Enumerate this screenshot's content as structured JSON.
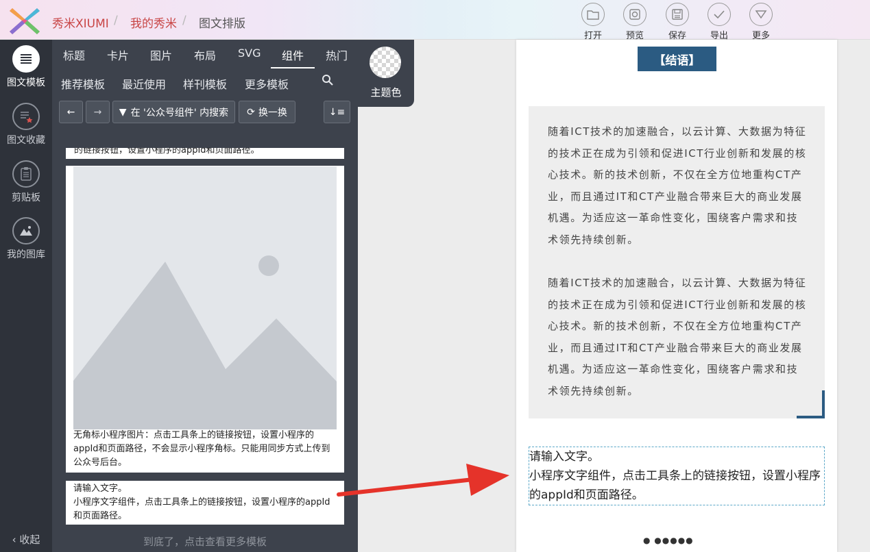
{
  "header": {
    "logo_icon": "xiumi-logo-icon",
    "breadcrumb": [
      "秀米XIUMI",
      "我的秀米",
      "图文排版"
    ],
    "tools": [
      {
        "label": "打开",
        "icon": "folder-icon"
      },
      {
        "label": "预览",
        "icon": "preview-icon"
      },
      {
        "label": "保存",
        "icon": "save-icon"
      },
      {
        "label": "导出",
        "icon": "check-icon"
      },
      {
        "label": "更多",
        "icon": "more-icon"
      }
    ]
  },
  "sidebar": {
    "items": [
      {
        "label": "图文模板",
        "icon": "template-icon"
      },
      {
        "label": "图文收藏",
        "icon": "favorites-icon"
      },
      {
        "label": "剪贴板",
        "icon": "clipboard-icon"
      },
      {
        "label": "我的图库",
        "icon": "gallery-icon"
      }
    ],
    "collapse_label": "收起"
  },
  "panel": {
    "tabs": [
      "标题",
      "卡片",
      "图片",
      "布局",
      "SVG",
      "组件",
      "热门"
    ],
    "active_tab": "组件",
    "subtabs": [
      "推荐模板",
      "最近使用",
      "样刊模板",
      "更多模板"
    ],
    "theme_label": "主题色",
    "search_button": "在 '公众号组件' 内搜索",
    "refresh_button": "换一换",
    "cards": {
      "top_partial": "的链接按钮，设置小程序的appId和页面路径。",
      "image_card_text": "无角标小程序图片：点击工具条上的链接按钮，设置小程序的appId和页面路径，不会显示小程序角标。只能用同步方式上传到公众号后台。",
      "text_card_title": "请输入文字。",
      "text_card_body": "小程序文字组件，点击工具条上的链接按钮，设置小程序的appId和页面路径。"
    },
    "bottom_text": "到底了，点击查看更多模板"
  },
  "editor": {
    "conclusion_label": "【结语】",
    "paragraph_1": "随着ICT技术的加速融合，以云计算、大数据为特征的技术正在成为引领和促进ICT行业创新和发展的核心技术。新的技术创新，不仅在全方位地重构CT产业，而且通过IT和CT产业融合带来巨大的商业发展机遇。为适应这一革命性变化，围绕客户需求和技术领先持续创新。",
    "paragraph_2": "随着ICT技术的加速融合，以云计算、大数据为特征的技术正在成为引领和促进ICT行业创新和发展的核心技术。新的技术创新，不仅在全方位地重构CT产业，而且通过IT和CT产业融合带来巨大的商业发展机遇。为适应这一革命性变化，围绕客户需求和技术领先持续创新。",
    "mini_title": "请输入文字。",
    "mini_body": "小程序文字组件，点击工具条上的链接按钮，设置小程序的appId和页面路径。",
    "page_dots": "● ●●●●●"
  },
  "colors": {
    "accent_red": "#e5332a",
    "navy": "#2b5b82",
    "panel_bg": "#3d424c",
    "sidebar_bg": "#2e323a"
  }
}
